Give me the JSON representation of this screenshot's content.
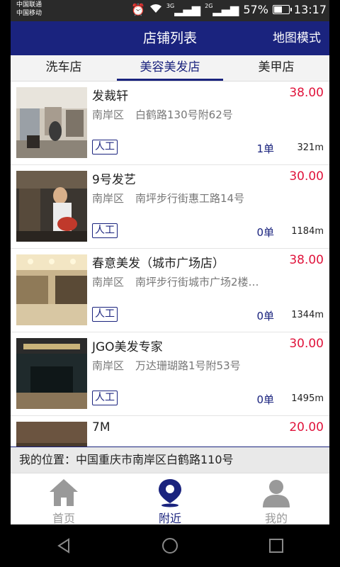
{
  "status_bar": {
    "carrier1": "中国联通",
    "carrier2": "中国移动",
    "net1": "3G",
    "net2": "2G",
    "battery": "57%",
    "time": "13:17"
  },
  "header": {
    "title": "店铺列表",
    "map_mode": "地图模式"
  },
  "tabs": [
    {
      "label": "洗车店"
    },
    {
      "label": "美容美发店"
    },
    {
      "label": "美甲店"
    }
  ],
  "shops": [
    {
      "name": "发裁轩",
      "price": "38.00",
      "district": "南岸区",
      "address": "白鹤路130号附62号",
      "service": "人工",
      "orders": "1单",
      "distance": "321m"
    },
    {
      "name": "9号发艺",
      "price": "30.00",
      "district": "南岸区",
      "address": "南坪步行街惠工路14号",
      "service": "人工",
      "orders": "0单",
      "distance": "1184m"
    },
    {
      "name": "春意美发（城市广场店）",
      "price": "38.00",
      "district": "南岸区",
      "address": "南坪步行街城市广场2楼…",
      "service": "人工",
      "orders": "0单",
      "distance": "1344m"
    },
    {
      "name": "JGO美发专家",
      "price": "30.00",
      "district": "南岸区",
      "address": "万达珊瑚路1号附53号",
      "service": "人工",
      "orders": "0单",
      "distance": "1495m"
    },
    {
      "name": "7M",
      "price": "20.00"
    }
  ],
  "location": {
    "text": "我的位置：中国重庆市南岸区白鹤路110号"
  },
  "bottom_nav": [
    {
      "label": "首页"
    },
    {
      "label": "附近"
    },
    {
      "label": "我的"
    }
  ],
  "colors": {
    "primary": "#1a237e",
    "price": "#e0143c"
  }
}
